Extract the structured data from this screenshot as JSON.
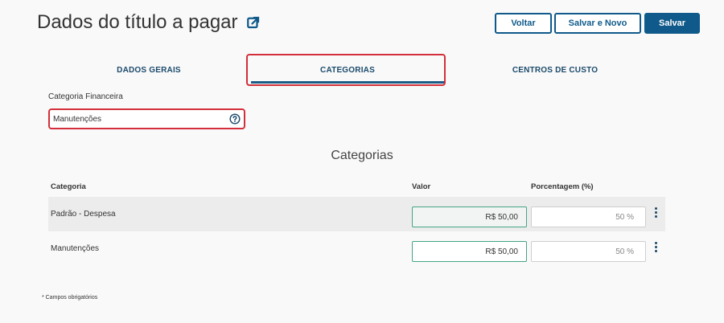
{
  "page": {
    "title": "Dados do título a pagar"
  },
  "toolbar": {
    "back_label": "Voltar",
    "save_new_label": "Salvar e Novo",
    "save_label": "Salvar"
  },
  "tabs": [
    {
      "label": "DADOS GERAIS"
    },
    {
      "label": "CATEGORIAS"
    },
    {
      "label": "CENTROS DE CUSTO"
    }
  ],
  "active_tab": "CATEGORIAS",
  "financial_category": {
    "label": "Categoria Financeira",
    "value": "Manutenções"
  },
  "categories_section": {
    "title": "Categorias",
    "columns": [
      "Categoria",
      "Valor",
      "Porcentagem (%)"
    ],
    "rows": [
      {
        "category": "Padrão - Despesa",
        "value": "R$ 50,00",
        "percent": "50 %"
      },
      {
        "category": "Manutenções",
        "value": "R$ 50,00",
        "percent": "50 %"
      }
    ]
  },
  "footnote": "* Campos obrigatórios",
  "colors": {
    "primary": "#0f5a8a",
    "highlight": "#d32f3a",
    "value_border": "#44a486"
  },
  "icons": {
    "external_link": "external-link-icon",
    "help": "help-circle-icon",
    "row_menu": "kebab-menu-icon"
  }
}
